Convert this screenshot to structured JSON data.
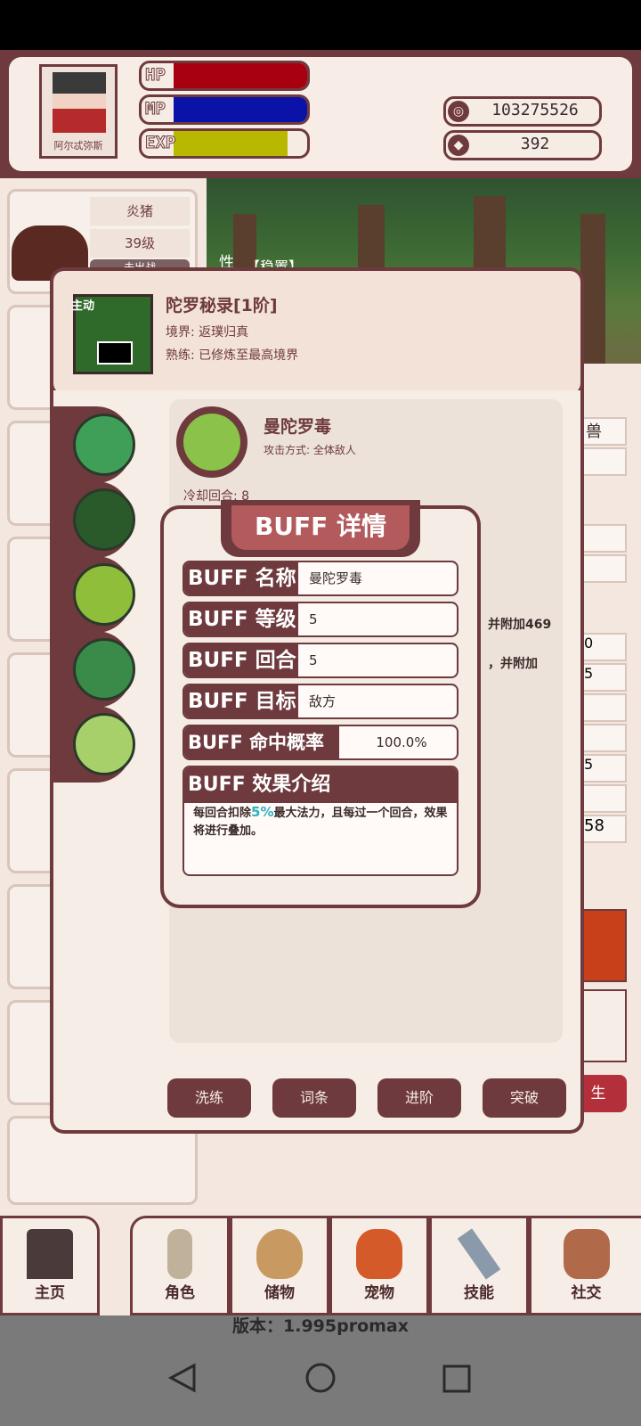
{
  "player": {
    "name": "阿尔忒弥斯",
    "hp_label": "HP",
    "mp_label": "MP",
    "exp_label": "EXP",
    "hp_fill": 1.0,
    "mp_fill": 1.0,
    "exp_fill": 0.85,
    "gold": "103275526",
    "gems": "392"
  },
  "pet_list": {
    "first_name": "炎猪",
    "first_level": "39级",
    "first_status": "未出战"
  },
  "battle": {
    "tag": "性",
    "mode": "【稳置】"
  },
  "skill": {
    "tag": "主动",
    "title": "陀罗秘录[1阶]",
    "realm": "境界: 返璞归真",
    "mastery": "熟练: 已修炼至最高境界",
    "effect_name": "曼陀罗毒",
    "attack_mode": "攻击方式: 全体敌人",
    "cooldown": "冷却回合: 8",
    "side_text1": "并附加469",
    "side_text2": "，并附加",
    "buttons": [
      "洗练",
      "词条",
      "进阶",
      "突破"
    ]
  },
  "right_strip": [
    "兽",
    "0",
    "5",
    "5",
    "58",
    "生"
  ],
  "buff": {
    "title": "BUFF 详情",
    "rows": [
      {
        "key": "BUFF 名称",
        "value": "曼陀罗毒"
      },
      {
        "key": "BUFF 等级",
        "value": "5"
      },
      {
        "key": "BUFF 回合",
        "value": "5"
      },
      {
        "key": "BUFF 目标",
        "value": "敌方"
      },
      {
        "key": "BUFF 命中概率",
        "value": "100.0%"
      }
    ],
    "effect_key": "BUFF 效果介绍",
    "effect_text_pre": "每回合扣除",
    "effect_text_highlight": "5%",
    "effect_text_post": "最大法力，且每过一个回合，效果将进行叠加。",
    "highlight_color": "#2bb3c0"
  },
  "nav": {
    "items": [
      "主页",
      "角色",
      "储物",
      "宠物",
      "技能",
      "社交"
    ]
  },
  "version": "版本：1.995promax",
  "colors": {
    "primary": "#6e3a3e",
    "hp": "#a80010",
    "mp": "#0a12a8",
    "exp": "#b8b800"
  }
}
